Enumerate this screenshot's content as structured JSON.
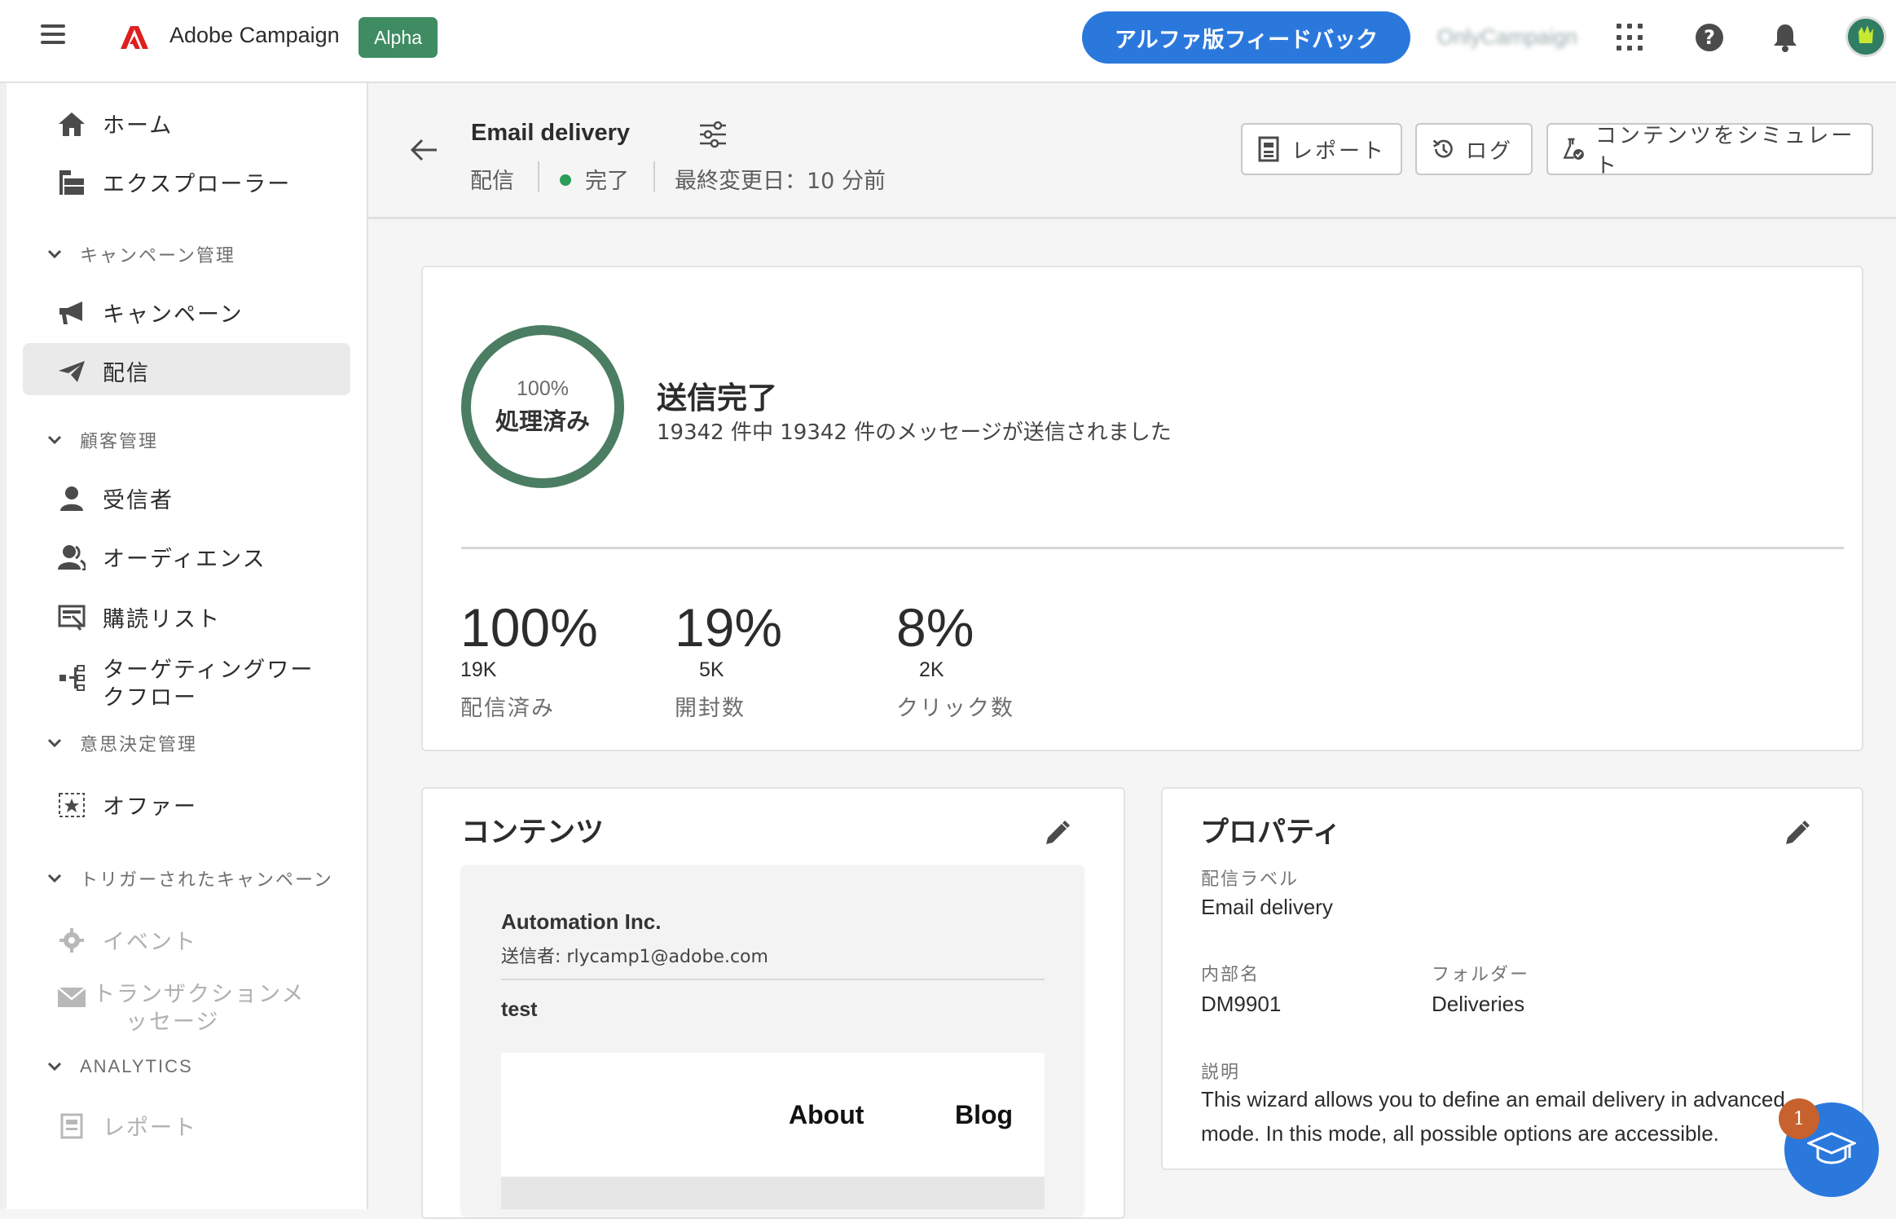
{
  "topbar": {
    "app_title": "Adobe Campaign",
    "badge": "Alpha",
    "feedback_button": "アルファ版フィードバック",
    "org_name": "OnlyCampaign",
    "help_symbol": "?"
  },
  "sidebar": {
    "home": "ホーム",
    "explorer": "エクスプローラー",
    "section_campaign": "キャンペーン管理",
    "campaigns": "キャンペーン",
    "deliveries": "配信",
    "section_customer": "顧客管理",
    "recipients": "受信者",
    "audiences": "オーディエンス",
    "subscriptions": "購読リスト",
    "targeting_line1": "ターゲティングワー",
    "targeting_line2": "クフロー",
    "section_decision": "意思決定管理",
    "offers": "オファー",
    "section_triggered": "トリガーされたキャンペーン",
    "events": "イベント",
    "transactional_line1": "トランザクションメ",
    "transactional_line2": "ッセージ",
    "section_analytics": "ANALYTICS",
    "reports": "レポート"
  },
  "header": {
    "title": "Email delivery",
    "type": "配信",
    "status": "完了",
    "last_modified": "最終変更日：10 分前",
    "report_button": "レポート",
    "log_button": "ログ",
    "simulate_button": "コンテンツをシミュレート"
  },
  "summary": {
    "progress_percent": "100%",
    "progress_label": "処理済み",
    "progress_value": 1.0,
    "heading": "送信完了",
    "message": "19342 件中 19342 件のメッセージが送信されました",
    "kpis": [
      {
        "percent": "100%",
        "count": "19K",
        "label": "配信済み"
      },
      {
        "percent": "19%",
        "count": "5K",
        "label": "開封数"
      },
      {
        "percent": "8%",
        "count": "2K",
        "label": "クリック数"
      }
    ]
  },
  "content": {
    "title": "コンテンツ",
    "sender_name": "Automation Inc.",
    "sender_label": "送信者: rlycamp1@adobe.com",
    "subject": "test",
    "nav_about": "About",
    "nav_blog": "Blog"
  },
  "properties": {
    "title": "プロパティ",
    "label_caption": "配信ラベル",
    "label_value": "Email delivery",
    "internal_caption": "内部名",
    "internal_value": "DM9901",
    "folder_caption": "フォルダー",
    "folder_value": "Deliveries",
    "desc_caption": "説明",
    "desc_line1": "This wizard allows you to define an email delivery in advanced",
    "desc_line2": "mode. In this mode, all possible options are accessible."
  },
  "fab": {
    "badge_count": "1"
  },
  "colors": {
    "accent": "#2b78dd",
    "alpha_badge": "#3f8c63",
    "ring": "#4a7d61",
    "status_dot": "#2d9d5c",
    "badge": "#c7612d"
  }
}
